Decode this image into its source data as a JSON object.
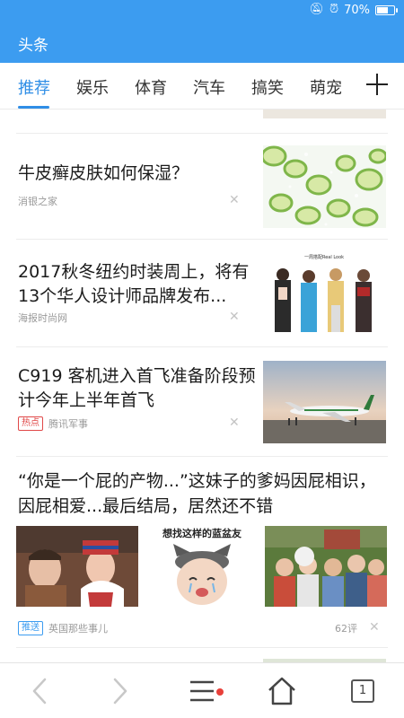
{
  "status_bar": {
    "icons": [
      "mute-bell-icon",
      "alarm-icon",
      "battery-icon"
    ],
    "battery": "70%",
    "battery_level": 0.7
  },
  "header": {
    "title": "头条",
    "background": "#3c9cf0"
  },
  "tabs": {
    "items": [
      {
        "label": "推荐",
        "active": true
      },
      {
        "label": "娱乐"
      },
      {
        "label": "体育"
      },
      {
        "label": "汽车"
      },
      {
        "label": "搞笑"
      },
      {
        "label": "萌宠"
      }
    ],
    "add_icon": "plus-icon",
    "active_color": "#2f8ee6"
  },
  "feed": {
    "articles": [
      {
        "title": "牛皮癣皮肤如何保湿？",
        "source": "消银之家",
        "thumbnail_icon": "cucumber-slices-image"
      },
      {
        "title": "2017秋冬纽约时装周上，将有13个华人设计师品牌发布...",
        "source": "海报时尚网",
        "thumbnail_icon": "fashion-models-image",
        "thumbnail_caption": "一周搭配Real Look"
      },
      {
        "title": "C919 客机进入首飞准备阶段预计今年上半年首飞",
        "badge": "热点",
        "source": "腾讯军事",
        "thumbnail_icon": "airplane-image"
      }
    ],
    "gallery_article": {
      "title": "“你是一个屁的产物...”这妹子的爹妈因屁相识，因屁相爱...最后结局，居然还不错",
      "images": [
        {
          "icon": "couple-photo-image"
        },
        {
          "icon": "cat-meme-image",
          "caption": "想找这样的蓝盆友"
        },
        {
          "icon": "family-photo-image"
        }
      ],
      "badge": "推送",
      "source": "英国那些事儿",
      "comments": "62评"
    }
  },
  "bottom_nav": {
    "back_icon": "chevron-left-icon",
    "forward_icon": "chevron-right-icon",
    "menu_icon": "menu-icon",
    "home_icon": "home-icon",
    "tab_count": "1",
    "notification_color": "#e8403a"
  }
}
